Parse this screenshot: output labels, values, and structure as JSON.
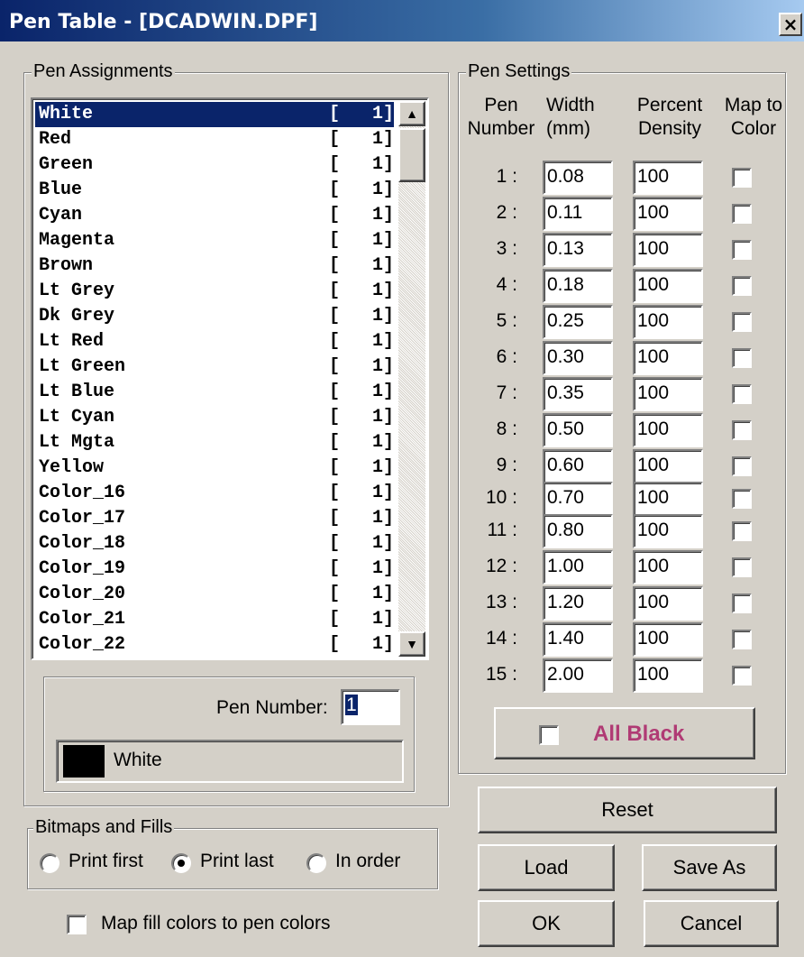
{
  "window": {
    "title": "Pen Table - [DCADWIN.DPF]",
    "close_glyph": "×"
  },
  "pen_assignments": {
    "legend": "Pen Assignments",
    "selected_index": 0,
    "items": [
      {
        "name": "White",
        "value": "[   1]"
      },
      {
        "name": "Red",
        "value": "[   1]"
      },
      {
        "name": "Green",
        "value": "[   1]"
      },
      {
        "name": "Blue",
        "value": "[   1]"
      },
      {
        "name": "Cyan",
        "value": "[   1]"
      },
      {
        "name": "Magenta",
        "value": "[   1]"
      },
      {
        "name": "Brown",
        "value": "[   1]"
      },
      {
        "name": "Lt Grey",
        "value": "[   1]"
      },
      {
        "name": "Dk Grey",
        "value": "[   1]"
      },
      {
        "name": "Lt Red",
        "value": "[   1]"
      },
      {
        "name": "Lt Green",
        "value": "[   1]"
      },
      {
        "name": "Lt Blue",
        "value": "[   1]"
      },
      {
        "name": "Lt Cyan",
        "value": "[   1]"
      },
      {
        "name": "Lt Mgta",
        "value": "[   1]"
      },
      {
        "name": "Yellow",
        "value": "[   1]"
      },
      {
        "name": "Color_16",
        "value": "[   1]"
      },
      {
        "name": "Color_17",
        "value": "[   1]"
      },
      {
        "name": "Color_18",
        "value": "[   1]"
      },
      {
        "name": "Color_19",
        "value": "[   1]"
      },
      {
        "name": "Color_20",
        "value": "[   1]"
      },
      {
        "name": "Color_21",
        "value": "[   1]"
      },
      {
        "name": "Color_22",
        "value": "[   1]"
      }
    ],
    "pen_number_label": "Pen Number:",
    "pen_number_value": "1",
    "swatch_color": "#000000",
    "color_name": "White"
  },
  "pen_settings": {
    "legend": "Pen Settings",
    "headers": {
      "pen_line1": "Pen",
      "pen_line2": "Number",
      "width_line1": "Width",
      "width_line2": "(mm)",
      "density_line1": "Percent",
      "density_line2": "Density",
      "map_line1": "Map to",
      "map_line2": "Color"
    },
    "rows": [
      {
        "label": "1 :",
        "width": "0.08",
        "density": "100",
        "map": false
      },
      {
        "label": "2 :",
        "width": "0.11",
        "density": "100",
        "map": false
      },
      {
        "label": "3 :",
        "width": "0.13",
        "density": "100",
        "map": false
      },
      {
        "label": "4 :",
        "width": "0.18",
        "density": "100",
        "map": false
      },
      {
        "label": "5 :",
        "width": "0.25",
        "density": "100",
        "map": false
      },
      {
        "label": "6 :",
        "width": "0.30",
        "density": "100",
        "map": false
      },
      {
        "label": "7 :",
        "width": "0.35",
        "density": "100",
        "map": false
      },
      {
        "label": "8 :",
        "width": "0.50",
        "density": "100",
        "map": false
      },
      {
        "label": "9 :",
        "width": "0.60",
        "density": "100",
        "map": false
      },
      {
        "label": "10 :",
        "width": "0.70",
        "density": "100",
        "map": false
      },
      {
        "label": "11 :",
        "width": "0.80",
        "density": "100",
        "map": false
      },
      {
        "label": "12 :",
        "width": "1.00",
        "density": "100",
        "map": false
      },
      {
        "label": "13 :",
        "width": "1.20",
        "density": "100",
        "map": false
      },
      {
        "label": "14 :",
        "width": "1.40",
        "density": "100",
        "map": false
      },
      {
        "label": "15 :",
        "width": "2.00",
        "density": "100",
        "map": false
      }
    ],
    "all_black_label": "All Black",
    "all_black_color": "#b03a74",
    "all_black_checked": false
  },
  "bitmaps": {
    "legend": "Bitmaps and Fills",
    "options": [
      "Print first",
      "Print last",
      "In order"
    ],
    "selected": 1
  },
  "map_fill_label": "Map fill colors to pen colors",
  "map_fill_checked": false,
  "buttons": {
    "reset": "Reset",
    "load": "Load",
    "save_as": "Save As",
    "ok": "OK",
    "cancel": "Cancel"
  }
}
